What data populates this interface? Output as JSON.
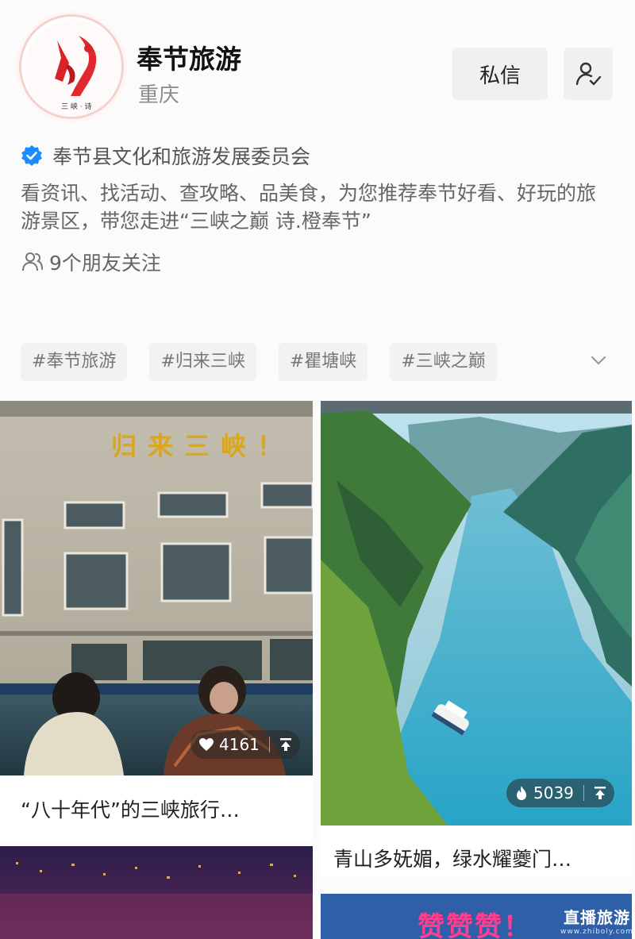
{
  "profile": {
    "name": "奉节旅游",
    "location": "重庆",
    "verified_org": "奉节县文化和旅游发展委员会",
    "bio": "看资讯、找活动、查攻略、品美食，为您推荐奉节好看、好玩的旅游景区，带您走进“三峡之巅 诗.橙奉节”",
    "friends_follow": "9个朋友关注"
  },
  "actions": {
    "message_label": "私信"
  },
  "tags": [
    "#奉节旅游",
    "#归来三峡",
    "#瞿塘峡",
    "#三峡之巅"
  ],
  "cards": [
    {
      "title": "“八十年代”的三峡旅行…",
      "likes": "4161",
      "sign_text": "归来三峡！"
    },
    {
      "title": "青山多妩媚，绿水耀夔门…",
      "likes": "5039"
    },
    {
      "title": ""
    },
    {
      "banner_text": "赞赞赞！"
    }
  ],
  "watermark": {
    "brand": "直播旅游",
    "domain": "www.zhiboly.com"
  },
  "colors": {
    "accent": "#1a8cff",
    "tag_bg": "#f2f2f2",
    "button_bg": "#f0f0f0"
  }
}
